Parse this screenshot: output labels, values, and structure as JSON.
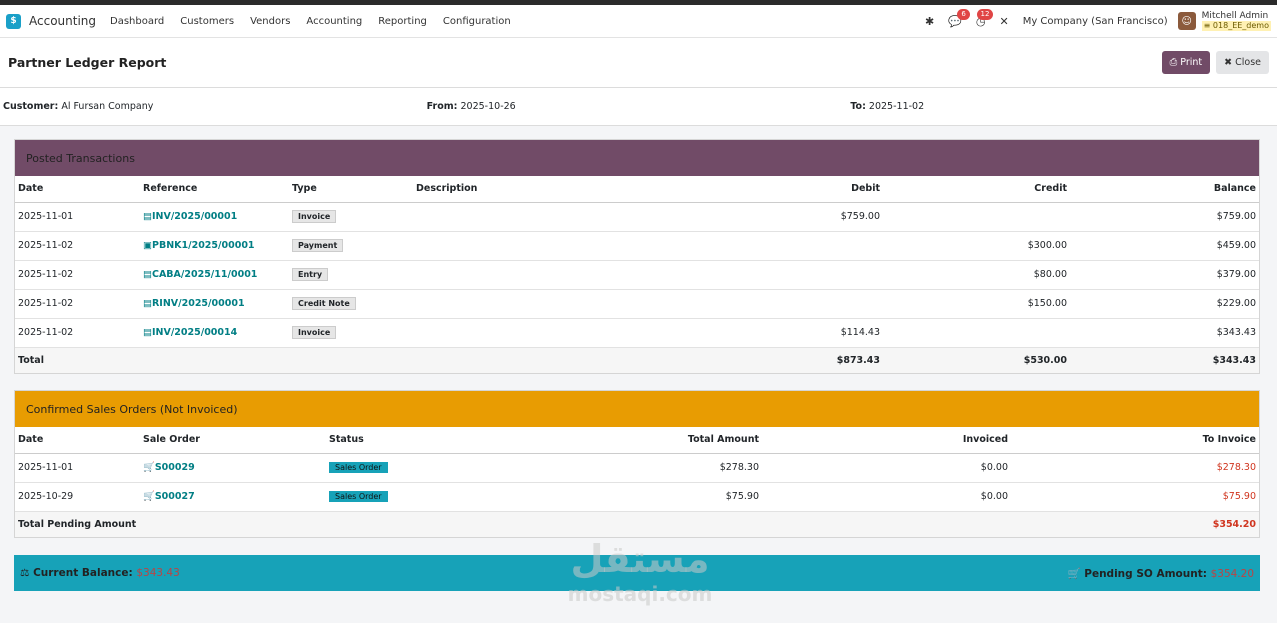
{
  "nav": {
    "app_name": "Accounting",
    "menu": [
      "Dashboard",
      "Customers",
      "Vendors",
      "Accounting",
      "Reporting",
      "Configuration"
    ],
    "messages_count": "6",
    "activities_count": "12",
    "company": "My Company (San Francisco)",
    "user_name": "Mitchell Admin",
    "db_name": "018_EE_demo"
  },
  "page": {
    "title": "Partner Ledger Report",
    "print_label": "Print",
    "close_label": "Close"
  },
  "filters": {
    "customer_label": "Customer:",
    "customer_value": "Al Fursan Company",
    "from_label": "From:",
    "from_value": "2025-10-26",
    "to_label": "To:",
    "to_value": "2025-11-02"
  },
  "posted": {
    "title": "Posted Transactions",
    "columns": [
      "Date",
      "Reference",
      "Type",
      "Description",
      "Debit",
      "Credit",
      "Balance"
    ],
    "rows": [
      {
        "date": "2025-11-01",
        "ref": "INV/2025/00001",
        "type": "Invoice",
        "desc": "",
        "debit": "$759.00",
        "credit": "",
        "balance": "$759.00"
      },
      {
        "date": "2025-11-02",
        "ref": "PBNK1/2025/00001",
        "type": "Payment",
        "desc": "",
        "debit": "",
        "credit": "$300.00",
        "balance": "$459.00"
      },
      {
        "date": "2025-11-02",
        "ref": "CABA/2025/11/0001",
        "type": "Entry",
        "desc": "",
        "debit": "",
        "credit": "$80.00",
        "balance": "$379.00"
      },
      {
        "date": "2025-11-02",
        "ref": "RINV/2025/00001",
        "type": "Credit Note",
        "desc": "",
        "debit": "",
        "credit": "$150.00",
        "balance": "$229.00"
      },
      {
        "date": "2025-11-02",
        "ref": "INV/2025/00014",
        "type": "Invoice",
        "desc": "",
        "debit": "$114.43",
        "credit": "",
        "balance": "$343.43"
      }
    ],
    "total": {
      "label": "Total",
      "debit": "$873.43",
      "credit": "$530.00",
      "balance": "$343.43"
    }
  },
  "orders": {
    "title": "Confirmed Sales Orders (Not Invoiced)",
    "columns": [
      "Date",
      "Sale Order",
      "Status",
      "Total Amount",
      "Invoiced",
      "To Invoice"
    ],
    "rows": [
      {
        "date": "2025-11-01",
        "order": "S00029",
        "status": "Sales Order",
        "total": "$278.30",
        "invoiced": "$0.00",
        "to_invoice": "$278.30"
      },
      {
        "date": "2025-10-29",
        "order": "S00027",
        "status": "Sales Order",
        "total": "$75.90",
        "invoiced": "$0.00",
        "to_invoice": "$75.90"
      }
    ],
    "total_label": "Total Pending Amount",
    "total_value": "$354.20"
  },
  "summary": {
    "current_balance_label": "Current Balance:",
    "current_balance_value": "$343.43",
    "pending_label": "Pending SO Amount:",
    "pending_value": "$354.20"
  },
  "watermark": {
    "arabic": "مستقل",
    "latin": "mostaqi.com"
  },
  "colors": {
    "posted_header": "#714b67",
    "orders_header": "#e89c02",
    "summary_bar": "#17a2b8",
    "link": "#017e84"
  }
}
